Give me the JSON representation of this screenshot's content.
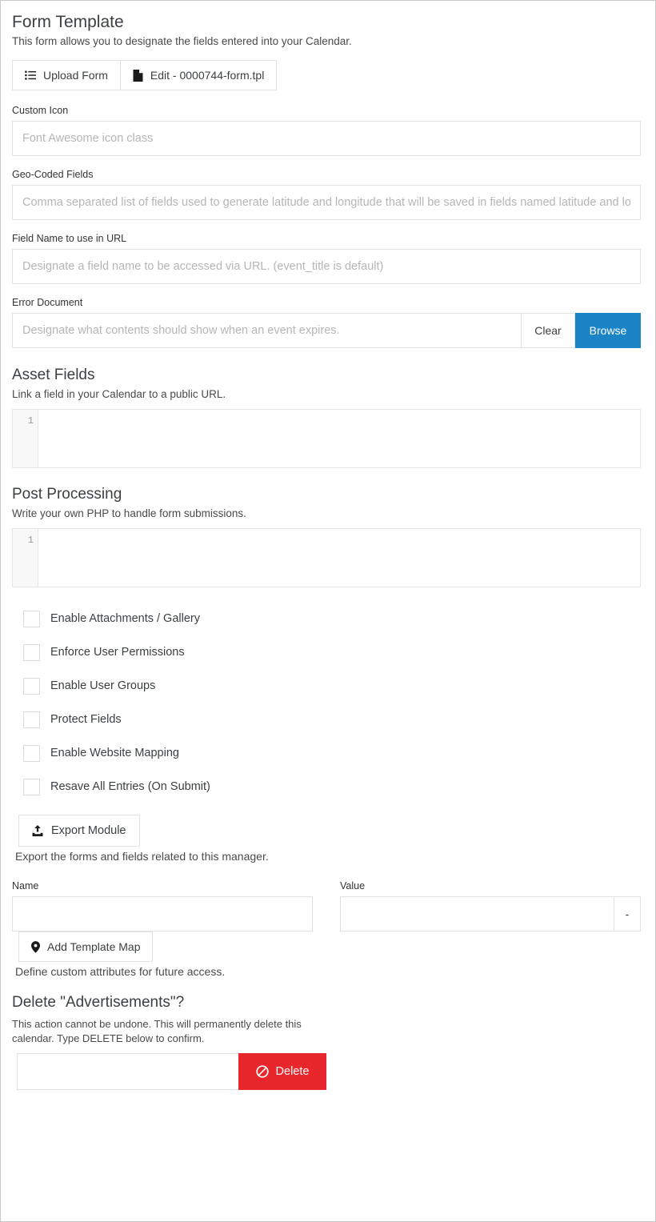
{
  "header": {
    "title": "Form Template",
    "subtitle": "This form allows you to designate the fields entered into your Calendar.",
    "upload_button": "Upload Form",
    "edit_button": "Edit - 0000744-form.tpl"
  },
  "fields": {
    "custom_icon": {
      "label": "Custom Icon",
      "placeholder": "Font Awesome icon class",
      "value": ""
    },
    "geo_coded": {
      "label": "Geo-Coded Fields",
      "placeholder": "Comma separated list of fields used to generate latitude and longitude that will be saved in fields named latitude and longitude.",
      "value": ""
    },
    "url_field_name": {
      "label": "Field Name to use in URL",
      "placeholder": "Designate a field name to be accessed via URL. (event_title is default)",
      "value": ""
    },
    "error_document": {
      "label": "Error Document",
      "placeholder": "Designate what contents should show when an event expires.",
      "value": "",
      "clear_label": "Clear",
      "browse_label": "Browse"
    }
  },
  "asset_fields": {
    "title": "Asset Fields",
    "description": "Link a field in your Calendar to a public URL.",
    "line_number": "1",
    "code": ""
  },
  "post_processing": {
    "title": "Post Processing",
    "description": "Write your own PHP to handle form submissions.",
    "line_number": "1",
    "code": ""
  },
  "checkboxes": [
    {
      "label": "Enable Attachments / Gallery",
      "checked": false
    },
    {
      "label": "Enforce User Permissions",
      "checked": false
    },
    {
      "label": "Enable User Groups",
      "checked": false
    },
    {
      "label": "Protect Fields",
      "checked": false
    },
    {
      "label": "Enable Website Mapping",
      "checked": false
    },
    {
      "label": "Resave All Entries (On Submit)",
      "checked": false
    }
  ],
  "export": {
    "button_label": "Export Module",
    "description": "Export the forms and fields related to this manager."
  },
  "template_map": {
    "name_label": "Name",
    "name_value": "",
    "value_label": "Value",
    "value_value": "",
    "remove_label": "-",
    "add_button": "Add Template Map",
    "description": "Define custom attributes for future access."
  },
  "delete": {
    "title": "Delete \"Advertisements\"?",
    "warning": "This action cannot be undone. This will permanently delete this calendar. Type DELETE below to confirm.",
    "input_value": "",
    "button_label": "Delete"
  },
  "colors": {
    "browse_blue": "#1a84c7",
    "delete_red": "#e8272c",
    "border": "#e2e2e2",
    "gutter": "#f8f8f8"
  }
}
